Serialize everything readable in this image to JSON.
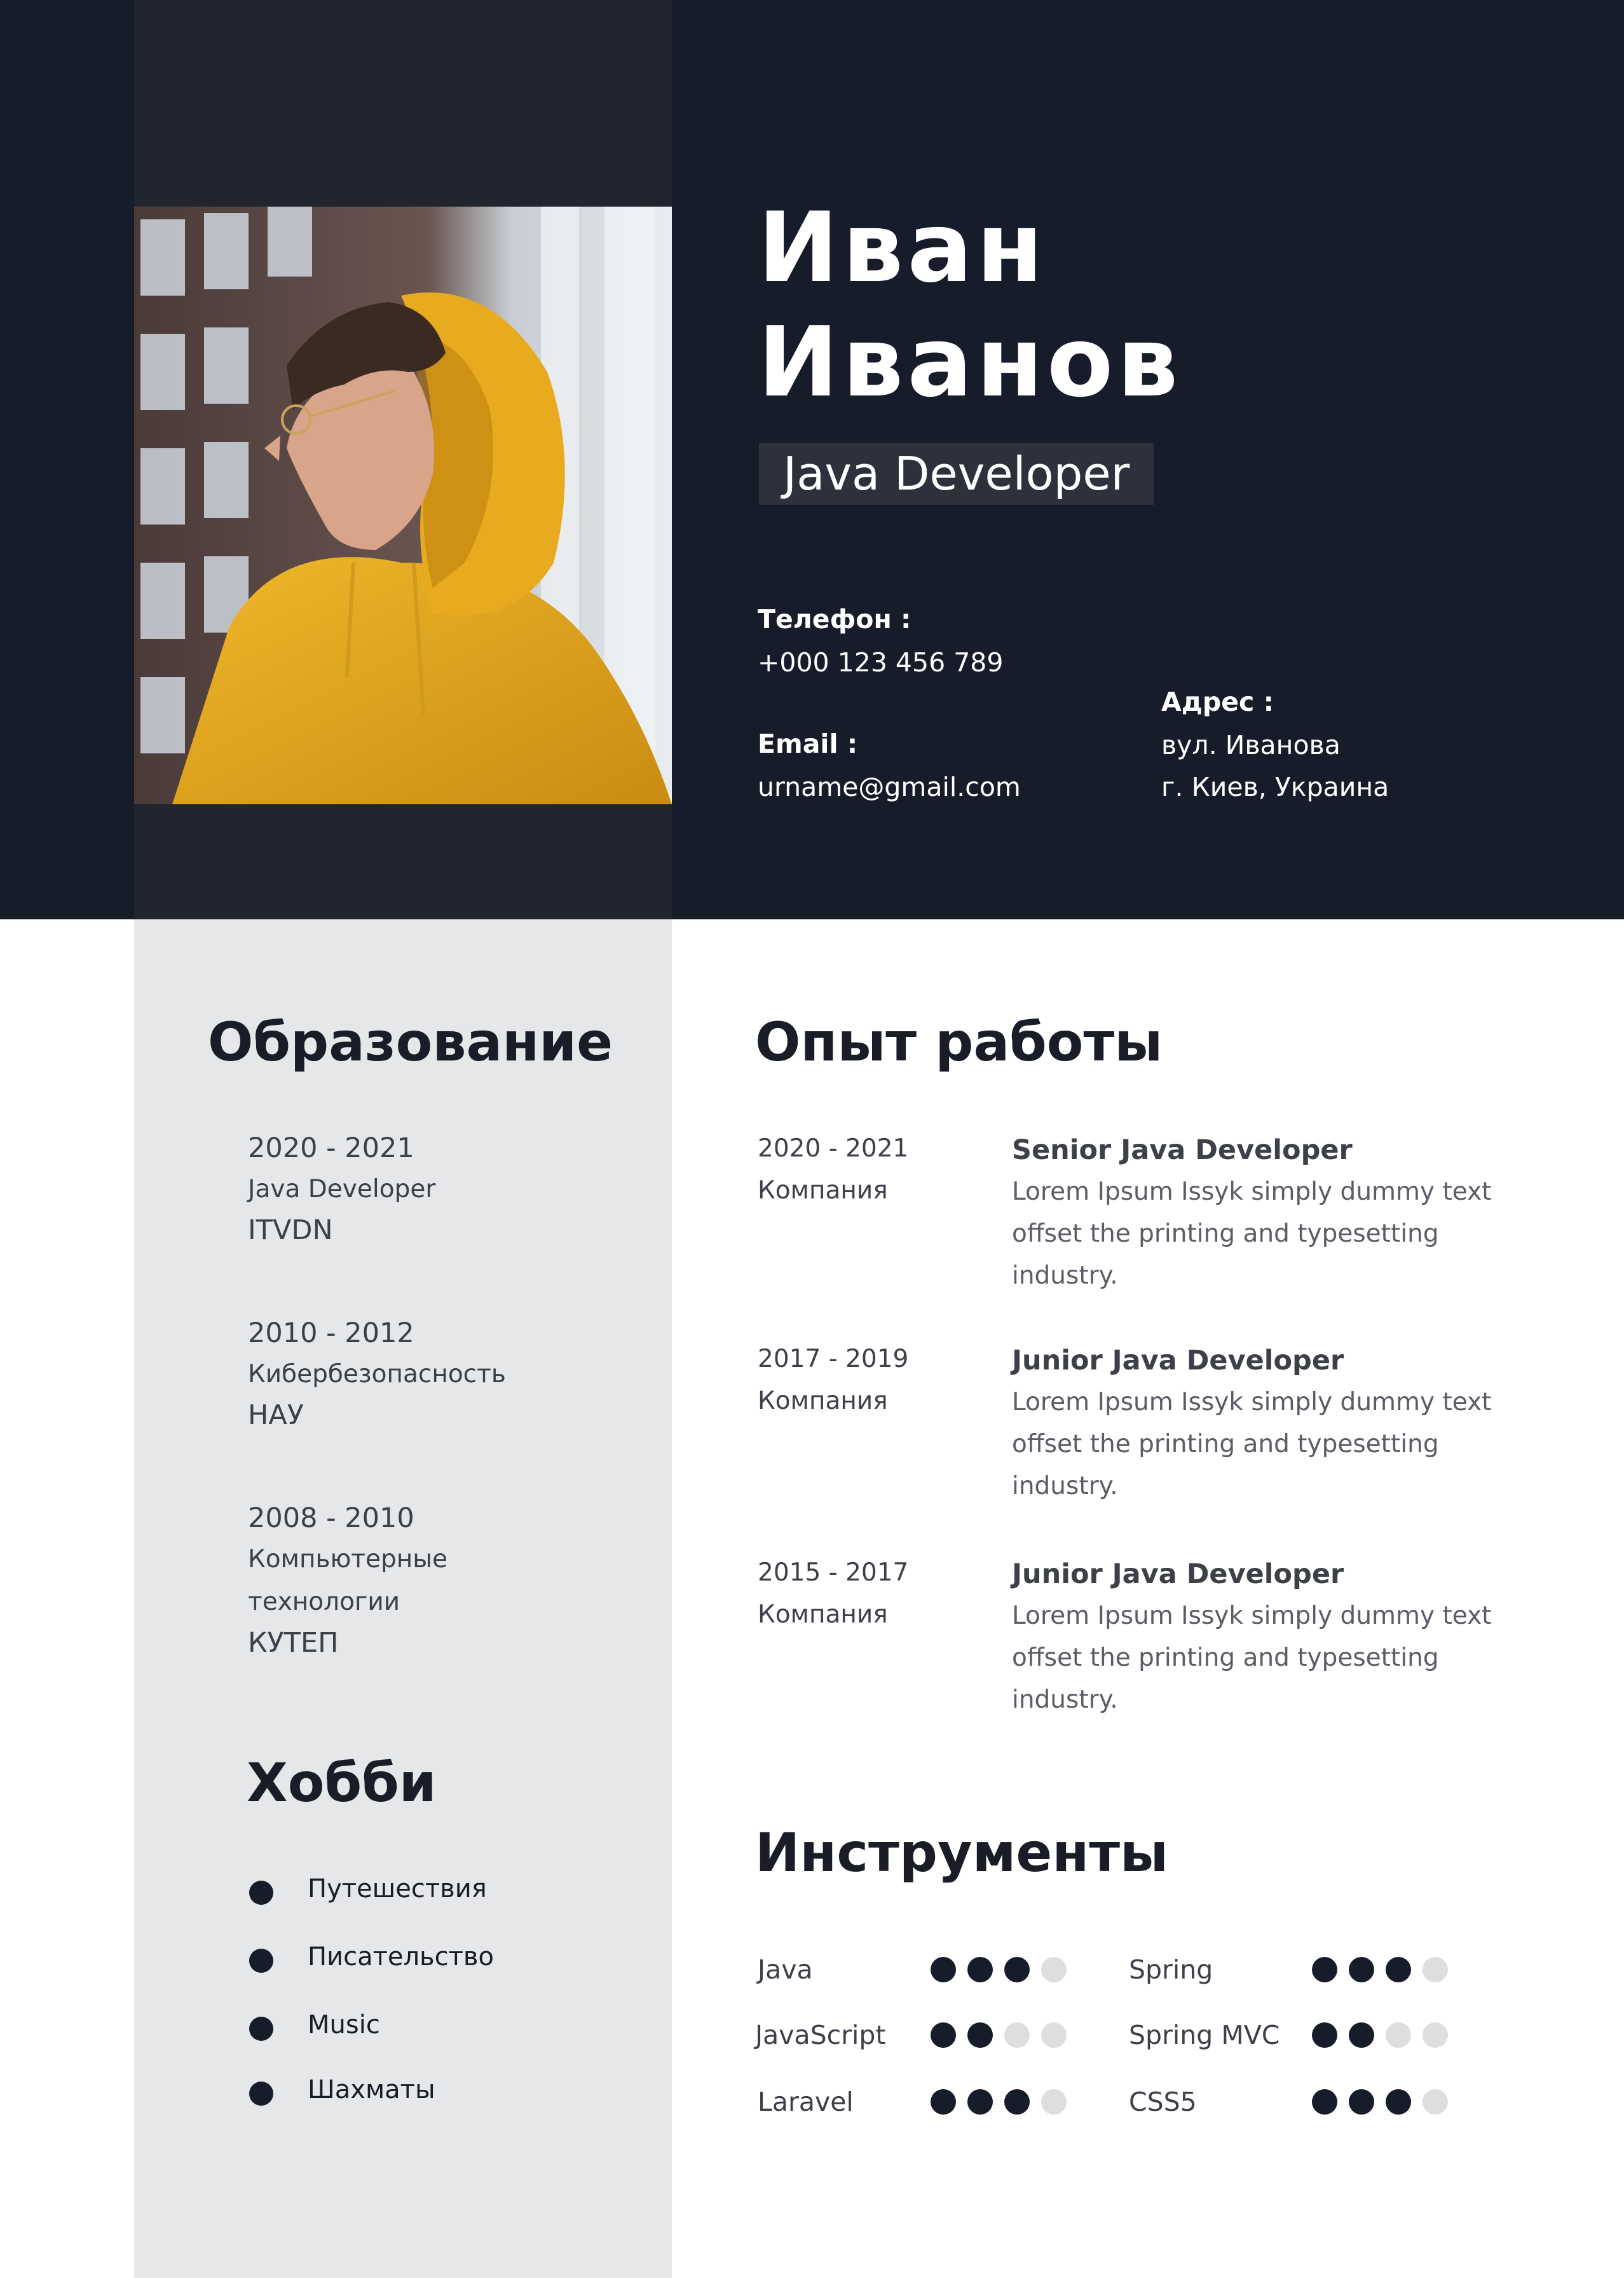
{
  "name": {
    "first": "Иван",
    "last": "Иванов"
  },
  "role": "Java Developer",
  "contacts": {
    "phone_label": "Телефон :",
    "phone": "+000 123 456 789",
    "email_label": "Email :",
    "email": "urname@gmail.com",
    "address_label": "Адрес :",
    "address_line1": "вул. Иванова",
    "address_line2": "г.  Киев, Украина"
  },
  "education": {
    "title": "Образование",
    "items": [
      {
        "years": "2020 - 2021",
        "lines": [
          "Java Developer"
        ],
        "institution": "ITVDN"
      },
      {
        "years": "2010 - 2012",
        "lines": [
          "Кибербезопасность"
        ],
        "institution": "НАУ"
      },
      {
        "years": "2008 - 2010",
        "lines": [
          "Компьютерные",
          "технологии"
        ],
        "institution": "КУТЕП"
      }
    ]
  },
  "hobbies": {
    "title": "Хобби",
    "items": [
      "Путешествия",
      "Писательство",
      "Music",
      "Шахматы"
    ]
  },
  "experience": {
    "title": "Опыт работы",
    "items": [
      {
        "years": "2020 - 2021",
        "company": "Компания",
        "position": "Senior Java Developer",
        "desc": [
          "Lorem Ipsum Issyk simply dummy text",
          "offset the printing and typesetting",
          "industry."
        ]
      },
      {
        "years": "2017 - 2019",
        "company": "Компания",
        "position": "Junior  Java Developer",
        "desc": [
          "Lorem Ipsum Issyk simply dummy text",
          "offset the printing and typesetting",
          "industry."
        ]
      },
      {
        "years": "2015 - 2017",
        "company": "Компания",
        "position": "Junior  Java Developer",
        "desc": [
          "Lorem Ipsum Issyk simply dummy text",
          "offset the printing and typesetting",
          "industry."
        ]
      }
    ]
  },
  "tools": {
    "title": "Инструменты",
    "items": [
      {
        "name": "Java",
        "level": 3,
        "max": 4
      },
      {
        "name": "Spring",
        "level": 3,
        "max": 4
      },
      {
        "name": "JavaScript",
        "level": 2,
        "max": 4
      },
      {
        "name": "Spring MVC",
        "level": 2,
        "max": 4
      },
      {
        "name": "Laravel",
        "level": 3,
        "max": 4
      },
      {
        "name": "CSS5",
        "level": 3,
        "max": 4
      }
    ]
  },
  "photo": {
    "subject": "young man in mustard yellow hoodie",
    "colors": {
      "hoodie": "#e0a51f",
      "background": "#5a4440"
    }
  },
  "colors": {
    "dark": "#171c2b",
    "sidebar_dark": "#21252f",
    "sidebar_light": "#e6e7e9",
    "dot_off": "#dddee0"
  }
}
